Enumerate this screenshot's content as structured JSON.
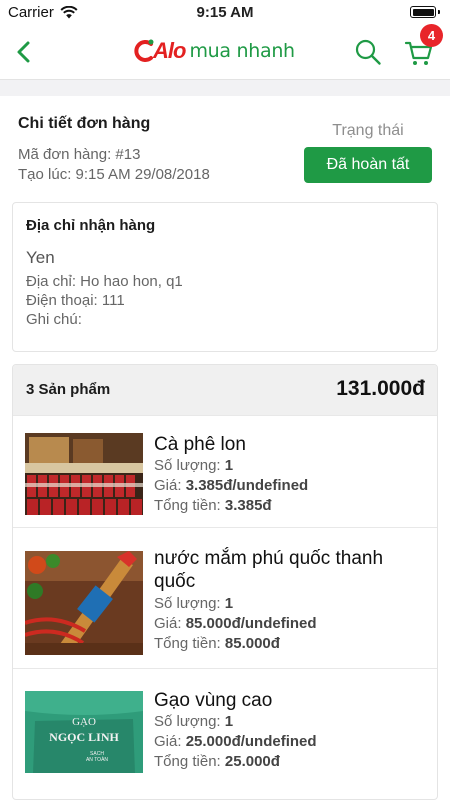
{
  "status_bar": {
    "carrier": "Carrier",
    "time": "9:15 AM"
  },
  "header": {
    "logo": {
      "alo": "Alo",
      "rest": "mua nhanh",
      "brand_red": "#e32121",
      "brand_green": "#1f9a45"
    },
    "cart_badge": "4"
  },
  "order": {
    "title": "Chi tiết đơn hàng",
    "code": "Mã đơn hàng: #13",
    "created": "Tạo lúc: 9:15 AM 29/08/2018",
    "status_label": "Trạng thái",
    "status_value": "Đã hoàn tất"
  },
  "address": {
    "title": "Địa chỉ nhận hàng",
    "name": "Yen",
    "address_line": "Địa chỉ: Ho hao hon, q1",
    "phone_line": "Điện thoại: 111",
    "note_line": "Ghi chú:"
  },
  "products": {
    "count_label": "3 Sản phẩm",
    "total": "131.000đ",
    "qty_label": "Số lượng:",
    "price_label": "Giá:",
    "subtotal_label": "Tổng tiền:",
    "items": [
      {
        "name": "Cà phê lon",
        "qty": "1",
        "price": "3.385đ/undefined",
        "subtotal": "3.385đ",
        "image": "canned-coffee-photo"
      },
      {
        "name": "nước mắm phú quốc thanh quốc",
        "qty": "1",
        "price": "85.000đ/undefined",
        "subtotal": "85.000đ",
        "image": "fish-sauce-bottle-photo"
      },
      {
        "name": "Gạo vùng cao",
        "qty": "1",
        "price": "25.000đ/undefined",
        "subtotal": "25.000đ",
        "image": "rice-bag-photo",
        "image_text": [
          "GẠO",
          "NGỌC LINH",
          "SẠCH",
          "AN TOÀN"
        ]
      }
    ]
  }
}
